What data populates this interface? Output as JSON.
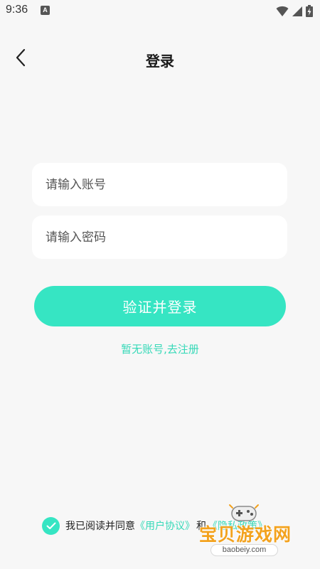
{
  "status_bar": {
    "time": "9:36",
    "notification_icon": "A",
    "icons": [
      "wifi-icon",
      "signal-icon",
      "battery-charging-icon"
    ]
  },
  "header": {
    "back_icon": "chevron-left-icon",
    "title": "登录"
  },
  "form": {
    "account_placeholder": "请输入账号",
    "password_placeholder": "请输入密码",
    "account_value": "",
    "password_value": ""
  },
  "actions": {
    "login_label": "验证并登录",
    "register_label": "暂无账号,去注册"
  },
  "agreement": {
    "checked": true,
    "prefix": "我已阅读并同意",
    "user_agreement": "《用户协议》",
    "and": "和",
    "privacy_policy": "《隐私政策》"
  },
  "watermark": {
    "title": "宝贝游戏网",
    "site": "baobeiy.com"
  },
  "colors": {
    "accent": "#36e5c3",
    "link": "#36d9b8",
    "background": "#f7f7f7",
    "watermark": "#f3a21d"
  }
}
